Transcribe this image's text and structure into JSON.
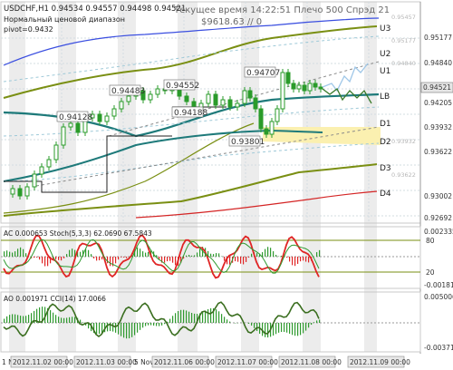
{
  "header": {
    "symbol_line": "USDCHF,H1  0.94534 0.94557 0.94498 0.94521",
    "range_label": "Нормальный ценовой диапазон",
    "pivot_label": "pivot=0.9432",
    "info_line": "Текущее время 14:22:51 Плечо 500 Спрэд 21",
    "balance_line": "$9618.63    // 0"
  },
  "levels": {
    "u3": "U3",
    "u2": "U2",
    "u1": "U1",
    "lb": "LB",
    "d1": "D1",
    "d2": "D2",
    "d3": "D3",
    "d4": "D4"
  },
  "annotations": {
    "a1": "0.94483",
    "a2": "0.94552",
    "a3": "0.94707",
    "a4": "0.94128",
    "a5": "0.94188",
    "a6": "0.93801"
  },
  "price_axis": {
    "labels": [
      "0.95457",
      "0.95177",
      "0.94840",
      "0.94521",
      "0.94205",
      "0.93932",
      "0.93622",
      "0.93002",
      "0.92692"
    ],
    "current": "0.94521"
  },
  "panel_ac_stoch": {
    "title": "AC 0.000653  Stoch(5,3,3) 62.0690 67.5843",
    "right_top": "0.002335",
    "right_bottom": "-0.00181",
    "level_80": "80",
    "level_20": "20"
  },
  "panel_ao_cci": {
    "title": "AO 0.001971  CCI(14) 17.0066",
    "right_top": "0.005006",
    "right_bottom": "-0.00371"
  },
  "time_axis": {
    "labels": [
      "1 Nov",
      "2012.11.02 00:00",
      "2012.11.03 00:00",
      "5 Nov",
      "2012.11.06 00:00",
      "2012.11.07 00:00",
      "2012.11.08 00:00",
      "2012.11.09 00:00"
    ]
  },
  "colors": {
    "background": "#ffffff",
    "grid": "#c8d6dd",
    "band_shade": "#e9e9e9",
    "bull_candle": "#2a9b2a",
    "bear_candle": "#2a9b2a",
    "envelope_olive": "#7a8f13",
    "teal_ma": "#1e7a7a",
    "blue_band": "#3b4fe0",
    "red_band": "#d42525",
    "zone_yellow": "#fbf0b0",
    "stoch_red": "#e02525",
    "stoch_green": "#2f9a2f",
    "osc_bar": "#2f9a2f"
  }
}
